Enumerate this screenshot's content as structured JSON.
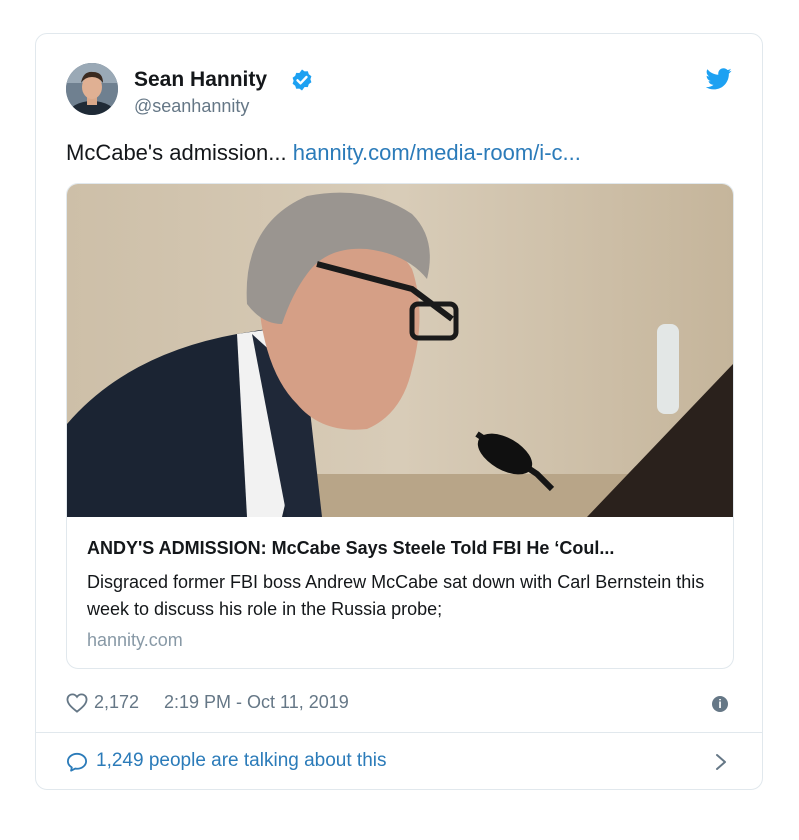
{
  "tweet": {
    "author": {
      "name": "Sean Hannity",
      "handle": "@seanhannity",
      "verified": true,
      "avatar_icon": "avatar"
    },
    "brand_icon": "twitter-bird-icon",
    "text": "McCabe's admission... ",
    "link_text": "hannity.com/media-room/i-c...",
    "card": {
      "image_icon": "article-photo",
      "title": "ANDY'S ADMISSION: McCabe Says Steele Told FBI He ‘Coul...",
      "description": "Disgraced former FBI boss Andrew McCabe sat down with Carl Bernstein this week to discuss his role in the Russia probe;",
      "domain": "hannity.com"
    },
    "likes": "2,172",
    "timestamp": "2:19 PM - Oct 11, 2019",
    "conversation": "1,249 people are talking about this",
    "colors": {
      "accent": "#1da1f2",
      "link": "#2b7bb9",
      "secondary_text": "#657786",
      "border": "#e1e8ed"
    }
  }
}
